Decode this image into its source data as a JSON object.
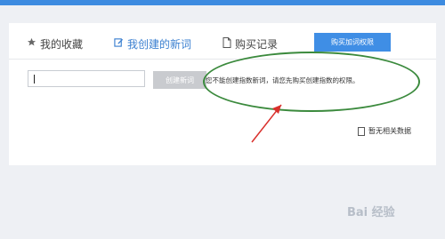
{
  "tabs": [
    {
      "label": "我的收藏",
      "icon": "star-icon"
    },
    {
      "label": "我创建的新词",
      "icon": "edit-icon"
    },
    {
      "label": "购买记录",
      "icon": "document-icon"
    }
  ],
  "buy_button": "购买加词权限",
  "create_button": "创建新词",
  "notice": "您不能创建指数新词，请您先购买创建指数的权限。",
  "empty_state": "暂无相关数据",
  "watermark": "Bai 经验",
  "colors": {
    "accent": "#3f8ee5",
    "annotation": "#3b8a3d",
    "arrow": "#d9302c"
  }
}
